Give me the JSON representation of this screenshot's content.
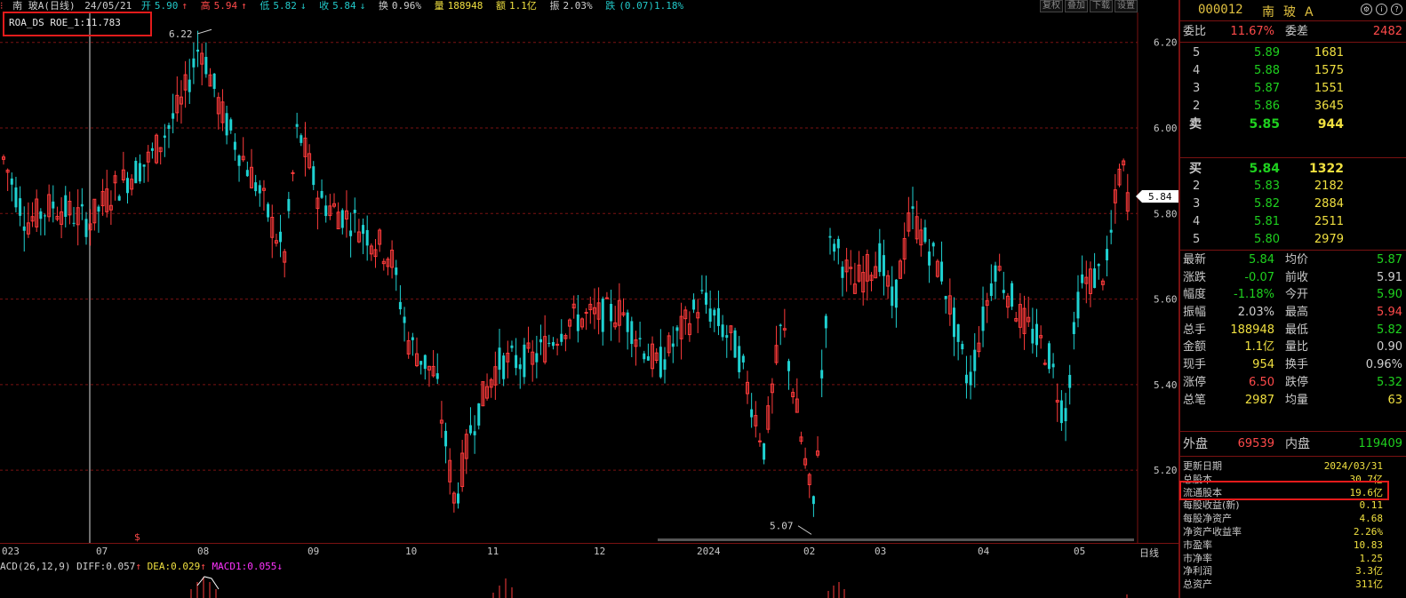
{
  "top_bar": {
    "name": "南  玻A(日线)",
    "date": "24/05/21",
    "open_label": "开",
    "open": "5.90",
    "high_label": "高",
    "high": "5.94",
    "low_label": "低",
    "low": "5.82",
    "close_label": "收",
    "close": "5.84",
    "turnover_label": "换",
    "turnover": "0.96%",
    "volume_label": "量",
    "volume": "188948",
    "amount_label": "额",
    "amount": "1.1亿",
    "amplitude_label": "振",
    "amplitude": "2.03%",
    "change_label": "跌",
    "change": "(0.07)1.18%",
    "buttons": [
      "复权",
      "叠加",
      "下载",
      "设置"
    ]
  },
  "indicator": {
    "text": "ROA_DS ROE_1:11.783"
  },
  "chart": {
    "price_labels": [
      "6.20",
      "6.00",
      "5.80",
      "5.60",
      "5.40",
      "5.20"
    ],
    "current_price": "5.84",
    "max_label": "6.22",
    "min_label": "5.07",
    "time_labels": [
      "023",
      "07",
      "08",
      "09",
      "10",
      "11",
      "12",
      "2024",
      "02",
      "03",
      "04",
      "05"
    ],
    "period": "日线",
    "colors": {
      "up": "#ff3b3b",
      "down": "#1fd1d1",
      "grid": "#7a1212"
    }
  },
  "macd": {
    "name": "ACD(26,12,9)",
    "diff_label": "DIFF:",
    "diff": "0.057",
    "dea_label": "DEA:",
    "dea": "0.029",
    "macd_label": "MACD1:",
    "macd": "0.055"
  },
  "panel": {
    "code": "000012",
    "name": "南玻A",
    "icons": [
      "settings-icon",
      "info-icon",
      "help-icon"
    ],
    "commission": {
      "ratio_label": "委比",
      "ratio": "11.67%",
      "diff_label": "委差",
      "diff": "2482"
    },
    "asks": [
      {
        "level": "5",
        "price": "5.89",
        "volume": "1681"
      },
      {
        "level": "4",
        "price": "5.88",
        "volume": "1575"
      },
      {
        "level": "3",
        "price": "5.87",
        "volume": "1551"
      },
      {
        "level": "2",
        "price": "5.86",
        "volume": "3645"
      },
      {
        "level": "卖",
        "price": "5.85",
        "volume": "944"
      }
    ],
    "bids": [
      {
        "level": "买",
        "price": "5.84",
        "volume": "1322"
      },
      {
        "level": "2",
        "price": "5.83",
        "volume": "2182"
      },
      {
        "level": "3",
        "price": "5.82",
        "volume": "2884"
      },
      {
        "level": "4",
        "price": "5.81",
        "volume": "2511"
      },
      {
        "level": "5",
        "price": "5.80",
        "volume": "2979"
      }
    ],
    "stats": [
      {
        "l1": "最新",
        "v1": "5.84",
        "c1": "green",
        "l2": "均价",
        "v2": "5.87",
        "c2": "green"
      },
      {
        "l1": "涨跌",
        "v1": "-0.07",
        "c1": "green",
        "l2": "前收",
        "v2": "5.91",
        "c2": "white"
      },
      {
        "l1": "幅度",
        "v1": "-1.18%",
        "c1": "green",
        "l2": "今开",
        "v2": "5.90",
        "c2": "green"
      },
      {
        "l1": "振幅",
        "v1": "2.03%",
        "c1": "white",
        "l2": "最高",
        "v2": "5.94",
        "c2": "red"
      },
      {
        "l1": "总手",
        "v1": "188948",
        "c1": "yellow",
        "l2": "最低",
        "v2": "5.82",
        "c2": "green"
      },
      {
        "l1": "金额",
        "v1": "1.1亿",
        "c1": "yellow",
        "l2": "量比",
        "v2": "0.90",
        "c2": "white"
      },
      {
        "l1": "现手",
        "v1": "954",
        "c1": "yellow",
        "l2": "换手",
        "v2": "0.96%",
        "c2": "white"
      },
      {
        "l1": "涨停",
        "v1": "6.50",
        "c1": "red",
        "l2": "跌停",
        "v2": "5.32",
        "c2": "green"
      },
      {
        "l1": "总笔",
        "v1": "2987",
        "c1": "yellow",
        "l2": "均量",
        "v2": "63",
        "c2": "yellow"
      }
    ],
    "outer": {
      "l1": "外盘",
      "v1": "69539",
      "l2": "内盘",
      "v2": "119409"
    },
    "finance": [
      {
        "label": "更新日期",
        "value": "2024/03/31"
      },
      {
        "label": "总股本",
        "value": "30.7亿"
      },
      {
        "label": "流通股本",
        "value": "19.6亿"
      },
      {
        "label": "每股收益(新)",
        "value": "0.11"
      },
      {
        "label": "每股净资产",
        "value": "4.68"
      },
      {
        "label": "净资产收益率",
        "value": "2.26%"
      },
      {
        "label": "市盈率",
        "value": "10.83"
      },
      {
        "label": "市净率",
        "value": "1.25"
      },
      {
        "label": "净利润",
        "value": "3.3亿"
      },
      {
        "label": "总资产",
        "value": "311亿"
      }
    ]
  }
}
